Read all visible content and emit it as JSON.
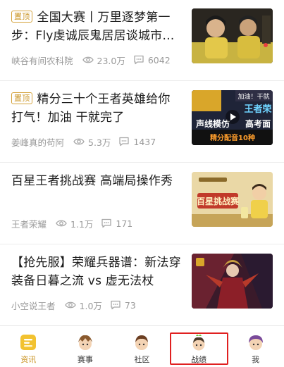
{
  "feed": {
    "items": [
      {
        "pinned": true,
        "badge": "置顶",
        "title": "全国大赛丨万里逐梦第一步：Fly虔诚辰鬼居居谈城市…",
        "author": "峡谷有间农科院",
        "views": "23.0万",
        "comments": "6042",
        "thumb_icon": "esports-players-photo"
      },
      {
        "pinned": true,
        "badge": "置顶",
        "title": "精分三十个王者英雄给你打气！加油 干就完了",
        "author": "姜峰真的苟阿",
        "views": "5.3万",
        "comments": "1437",
        "thumb_icon": "video-play-icon",
        "thumb_text": [
          "加油！干就",
          "王者荣",
          "声线模仿",
          "高考面",
          "精分配音10种"
        ]
      },
      {
        "pinned": false,
        "title": "百星王者挑战赛 高端局操作秀",
        "author": "王者荣耀",
        "views": "1.1万",
        "comments": "171",
        "thumb_icon": "challenge-banner",
        "thumb_text": [
          "百星挑战赛"
        ]
      },
      {
        "pinned": false,
        "title": "【抢先服】荣耀兵器谱：新法穿装备日暮之流 vs 虚无法杖",
        "author": "小空说王者",
        "views": "1.0万",
        "comments": "73",
        "thumb_icon": "hero-artwork"
      }
    ]
  },
  "tabbar": {
    "tabs": [
      {
        "label": "资讯",
        "icon": "news-icon",
        "active": true
      },
      {
        "label": "赛事",
        "icon": "match-avatar-icon",
        "active": false
      },
      {
        "label": "社区",
        "icon": "community-avatar-icon",
        "active": false
      },
      {
        "label": "战绩",
        "icon": "record-avatar-icon",
        "active": false,
        "highlighted": true
      },
      {
        "label": "我",
        "icon": "me-avatar-icon",
        "active": false
      }
    ]
  },
  "colors": {
    "accent": "#c9921f",
    "badge_border": "#d4a23a",
    "meta_text": "#9a9a9a",
    "highlight_box": "#e02020"
  }
}
